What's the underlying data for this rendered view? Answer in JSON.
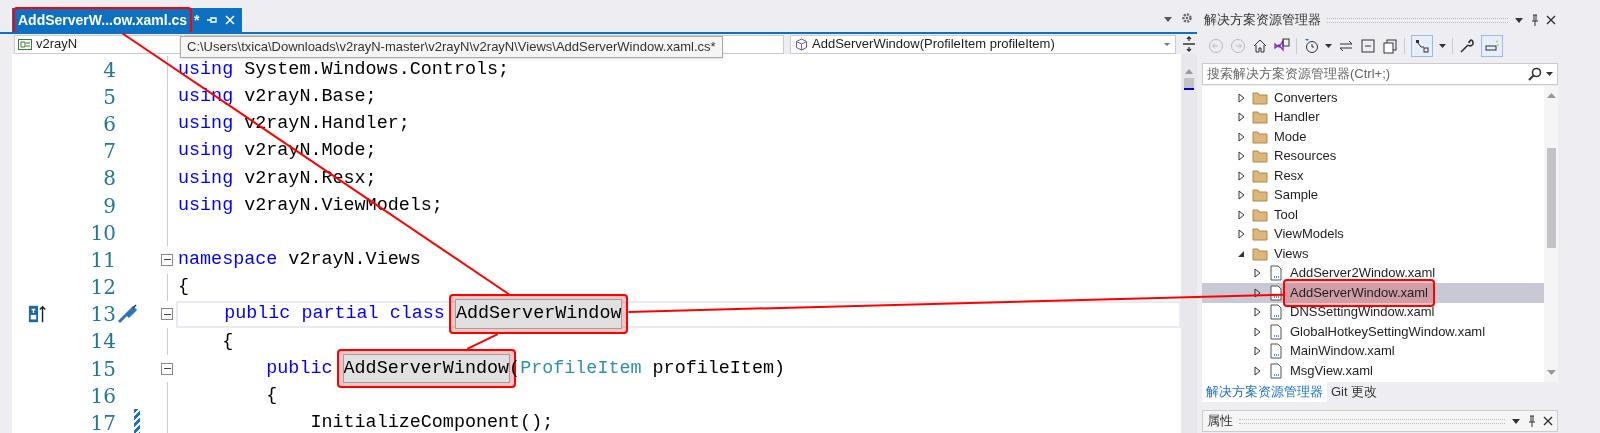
{
  "editor_tab": {
    "title": "AddServerW...ow.xaml.cs",
    "modified_mark": "*",
    "selected": true,
    "callout": true
  },
  "nav_bar": {
    "project": "v2rayN",
    "member": "AddServerWindow(ProfileItem profileItem)"
  },
  "tooltip": "C:\\Users\\txica\\Downloads\\v2rayN-master\\v2rayN\\v2rayN\\Views\\AddServerWindow.xaml.cs*",
  "code_lines": [
    {
      "number": "4",
      "foldable": false,
      "segments": [
        {
          "kind": "keyword",
          "text": "using"
        },
        {
          "kind": "plain",
          "text": " System.Windows.Controls;"
        }
      ]
    },
    {
      "number": "5",
      "foldable": false,
      "segments": [
        {
          "kind": "keyword",
          "text": "using"
        },
        {
          "kind": "plain",
          "text": " v2rayN.Base;"
        }
      ]
    },
    {
      "number": "6",
      "foldable": false,
      "segments": [
        {
          "kind": "keyword",
          "text": "using"
        },
        {
          "kind": "plain",
          "text": " v2rayN.Handler;"
        }
      ]
    },
    {
      "number": "7",
      "foldable": false,
      "segments": [
        {
          "kind": "keyword",
          "text": "using"
        },
        {
          "kind": "plain",
          "text": " v2rayN.Mode;"
        }
      ]
    },
    {
      "number": "8",
      "foldable": false,
      "segments": [
        {
          "kind": "keyword",
          "text": "using"
        },
        {
          "kind": "plain",
          "text": " v2rayN.Resx;"
        }
      ]
    },
    {
      "number": "9",
      "foldable": false,
      "segments": [
        {
          "kind": "keyword",
          "text": "using"
        },
        {
          "kind": "plain",
          "text": " v2rayN.ViewModels;"
        }
      ]
    },
    {
      "number": "10",
      "foldable": false
    },
    {
      "number": "11",
      "foldable": true,
      "segments": [
        {
          "kind": "keyword",
          "text": "namespace"
        },
        {
          "kind": "plain",
          "text": " v2rayN.Views"
        }
      ]
    },
    {
      "number": "12",
      "foldable": false,
      "segments": [
        {
          "kind": "plain",
          "text": "{"
        }
      ]
    },
    {
      "number": "13",
      "foldable": true,
      "current": true,
      "glyphs": true,
      "segments": [
        {
          "kind": "keyword",
          "text": "    public partial class "
        },
        {
          "kind": "reference",
          "text": "AddServerWindow",
          "callout": true,
          "hub": true
        }
      ]
    },
    {
      "number": "14",
      "foldable": false,
      "segments": [
        {
          "kind": "plain",
          "text": "    {"
        }
      ]
    },
    {
      "number": "15",
      "foldable": true,
      "segments": [
        {
          "kind": "keyword",
          "text": "        public "
        },
        {
          "kind": "reference",
          "text": "AddServerWindow",
          "callout": true
        },
        {
          "kind": "plain",
          "text": "("
        },
        {
          "kind": "type",
          "text": "ProfileItem"
        },
        {
          "kind": "plain",
          "text": " profileItem)"
        }
      ]
    },
    {
      "number": "16",
      "foldable": false,
      "segments": [
        {
          "kind": "plain",
          "text": "        {"
        }
      ]
    },
    {
      "number": "17",
      "foldable": false,
      "change": true,
      "segments": [
        {
          "kind": "plain",
          "text": "            InitializeComponent();"
        }
      ]
    }
  ],
  "solution_explorer": {
    "title": "解决方案资源管理器",
    "search": {
      "placeholder": "搜索解决方案资源管理器(Ctrl+;)"
    },
    "items": [
      {
        "label": "Converters",
        "kind": "folder",
        "expanded": false,
        "selected": false
      },
      {
        "label": "Handler",
        "kind": "folder",
        "expanded": false,
        "selected": false
      },
      {
        "label": "Mode",
        "kind": "folder",
        "expanded": false,
        "selected": false
      },
      {
        "label": "Resources",
        "kind": "folder",
        "expanded": false,
        "selected": false
      },
      {
        "label": "Resx",
        "kind": "folder",
        "expanded": false,
        "selected": false
      },
      {
        "label": "Sample",
        "kind": "folder",
        "expanded": false,
        "selected": false
      },
      {
        "label": "Tool",
        "kind": "folder",
        "expanded": false,
        "selected": false
      },
      {
        "label": "ViewModels",
        "kind": "folder",
        "expanded": false,
        "selected": false
      },
      {
        "label": "Views",
        "kind": "folder",
        "expanded": true,
        "selected": false,
        "children": [
          {
            "label": "AddServer2Window.xaml",
            "kind": "file",
            "expanded": false,
            "selected": false
          },
          {
            "label": "AddServerWindow.xaml",
            "kind": "file",
            "expanded": false,
            "selected": true,
            "callout": true
          },
          {
            "label": "DNSSettingWindow.xaml",
            "kind": "file",
            "expanded": false,
            "selected": false
          },
          {
            "label": "GlobalHotkeySettingWindow.xaml",
            "kind": "file",
            "expanded": false,
            "selected": false
          },
          {
            "label": "MainWindow.xaml",
            "kind": "file",
            "expanded": false,
            "selected": false
          },
          {
            "label": "MsgView.xaml",
            "kind": "file",
            "expanded": false,
            "selected": false
          }
        ]
      }
    ],
    "tabs": [
      {
        "label": "解决方案资源管理器",
        "selected": true
      },
      {
        "label": "Git 更改",
        "selected": false
      }
    ]
  },
  "properties_panel": {
    "title": "属性"
  }
}
